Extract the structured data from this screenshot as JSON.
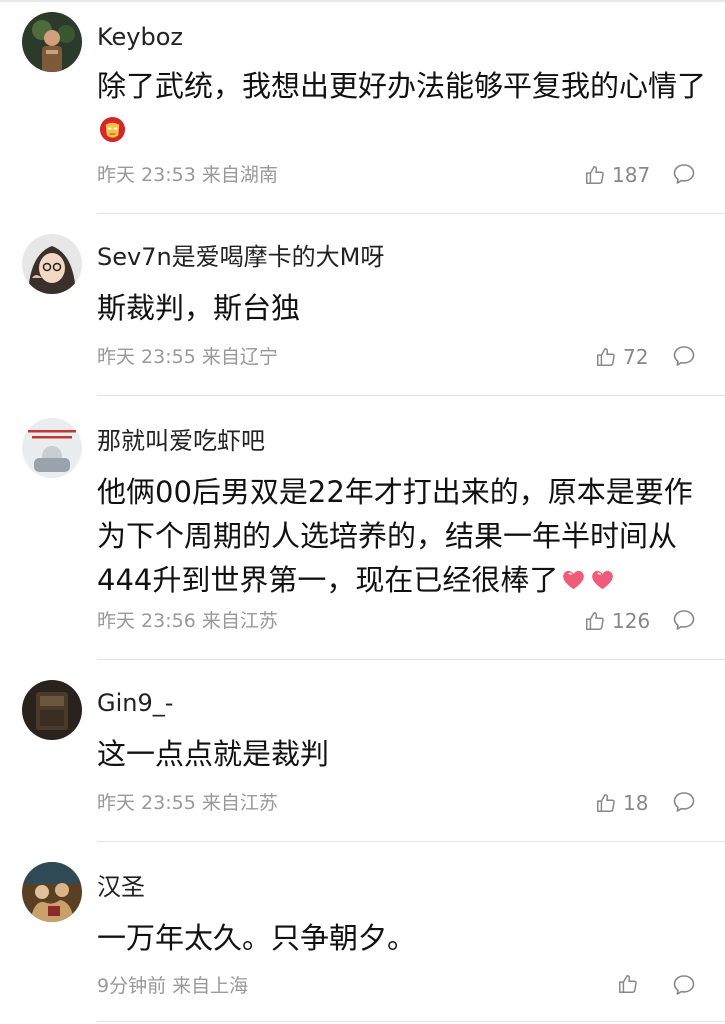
{
  "comments": [
    {
      "username": "Keyboz",
      "content": "除了武统，我想出更好办法能够平复我的心情了",
      "time": "昨天 23:53",
      "location": "来自湖南",
      "likes": "187",
      "emojis": [
        "iron-man-emoji"
      ],
      "avatar_colors": [
        "#2b3a2a",
        "#7d5a3a"
      ]
    },
    {
      "username": "Sev7n是爱喝摩卡的大M呀",
      "content": "斯裁判，斯台独",
      "time": "昨天 23:55",
      "location": "来自辽宁",
      "likes": "72",
      "emojis": [],
      "avatar_colors": [
        "#dcdcdc",
        "#3a2f2a"
      ]
    },
    {
      "username": "那就叫爱吃虾吧",
      "content_lines": [
        "他俩00后男双是22年才打出来的，原本是要作",
        "为下个周期的人选培养的，结果一年半时间从",
        "444升到世界第一，现在已经很棒了"
      ],
      "time": "昨天 23:56",
      "location": "来自江苏",
      "likes": "126",
      "emojis": [
        "heart-emoji",
        "heart-emoji"
      ],
      "avatar_colors": [
        "#cfd6dc",
        "#c0392b"
      ]
    },
    {
      "username": "Gin9_-",
      "content": "这一点点就是裁判",
      "time": "昨天 23:55",
      "location": "来自江苏",
      "likes": "18",
      "emojis": [],
      "avatar_colors": [
        "#4a3a2a",
        "#1e1a16"
      ]
    },
    {
      "username": "汉圣",
      "content": "一万年太久。只争朝夕。",
      "time": "9分钟前",
      "location": "来自上海",
      "likes": "",
      "emojis": [],
      "avatar_colors": [
        "#7a5a32",
        "#c9a06a"
      ]
    }
  ],
  "icons": {
    "like": "thumbs-up-icon",
    "reply": "comment-bubble-icon"
  },
  "colors": {
    "meta_text": "#999999",
    "divider": "#e3e3e3"
  }
}
